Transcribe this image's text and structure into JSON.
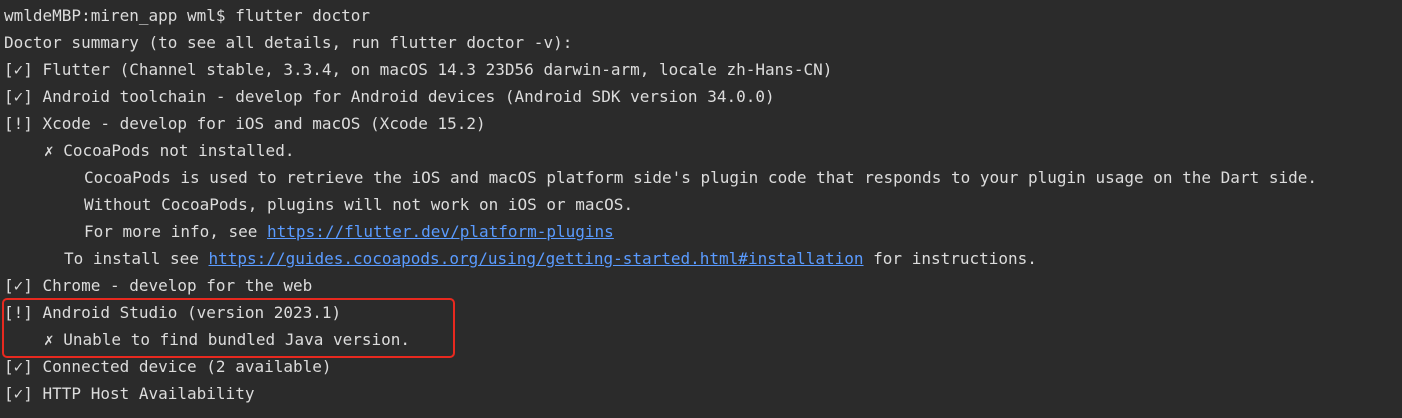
{
  "prompt": {
    "text": "wmldeMBP:miren_app wml$ flutter doctor"
  },
  "summary": "Doctor summary (to see all details, run flutter doctor -v):",
  "checks": {
    "flutter": "[✓] Flutter (Channel stable, 3.3.4, on macOS 14.3 23D56 darwin-arm, locale zh-Hans-CN)",
    "android_toolchain": "[✓] Android toolchain - develop for Android devices (Android SDK version 34.0.0)",
    "xcode": "[!] Xcode - develop for iOS and macOS (Xcode 15.2)",
    "xcode_cocoapods": "✗ CocoaPods not installed.",
    "xcode_detail_1": "CocoaPods is used to retrieve the iOS and macOS platform side's plugin code that responds to your plugin usage on the Dart side.",
    "xcode_detail_2": "Without CocoaPods, plugins will not work on iOS or macOS.",
    "xcode_detail_3_prefix": "For more info, see ",
    "xcode_detail_3_link": "https://flutter.dev/platform-plugins",
    "xcode_install_prefix": "To install see ",
    "xcode_install_link": "https://guides.cocoapods.org/using/getting-started.html#installation",
    "xcode_install_suffix": " for instructions.",
    "chrome": "[✓] Chrome - develop for the web",
    "android_studio": "[!] Android Studio (version 2023.1)",
    "android_studio_detail": "✗ Unable to find bundled Java version.",
    "connected_device": "[✓] Connected device (2 available)",
    "http_host": "[✓] HTTP Host Availability"
  },
  "colors": {
    "background": "#2b2b2b",
    "text": "#dcdcdc",
    "link": "#5a9bff",
    "highlight": "#e8291f"
  }
}
